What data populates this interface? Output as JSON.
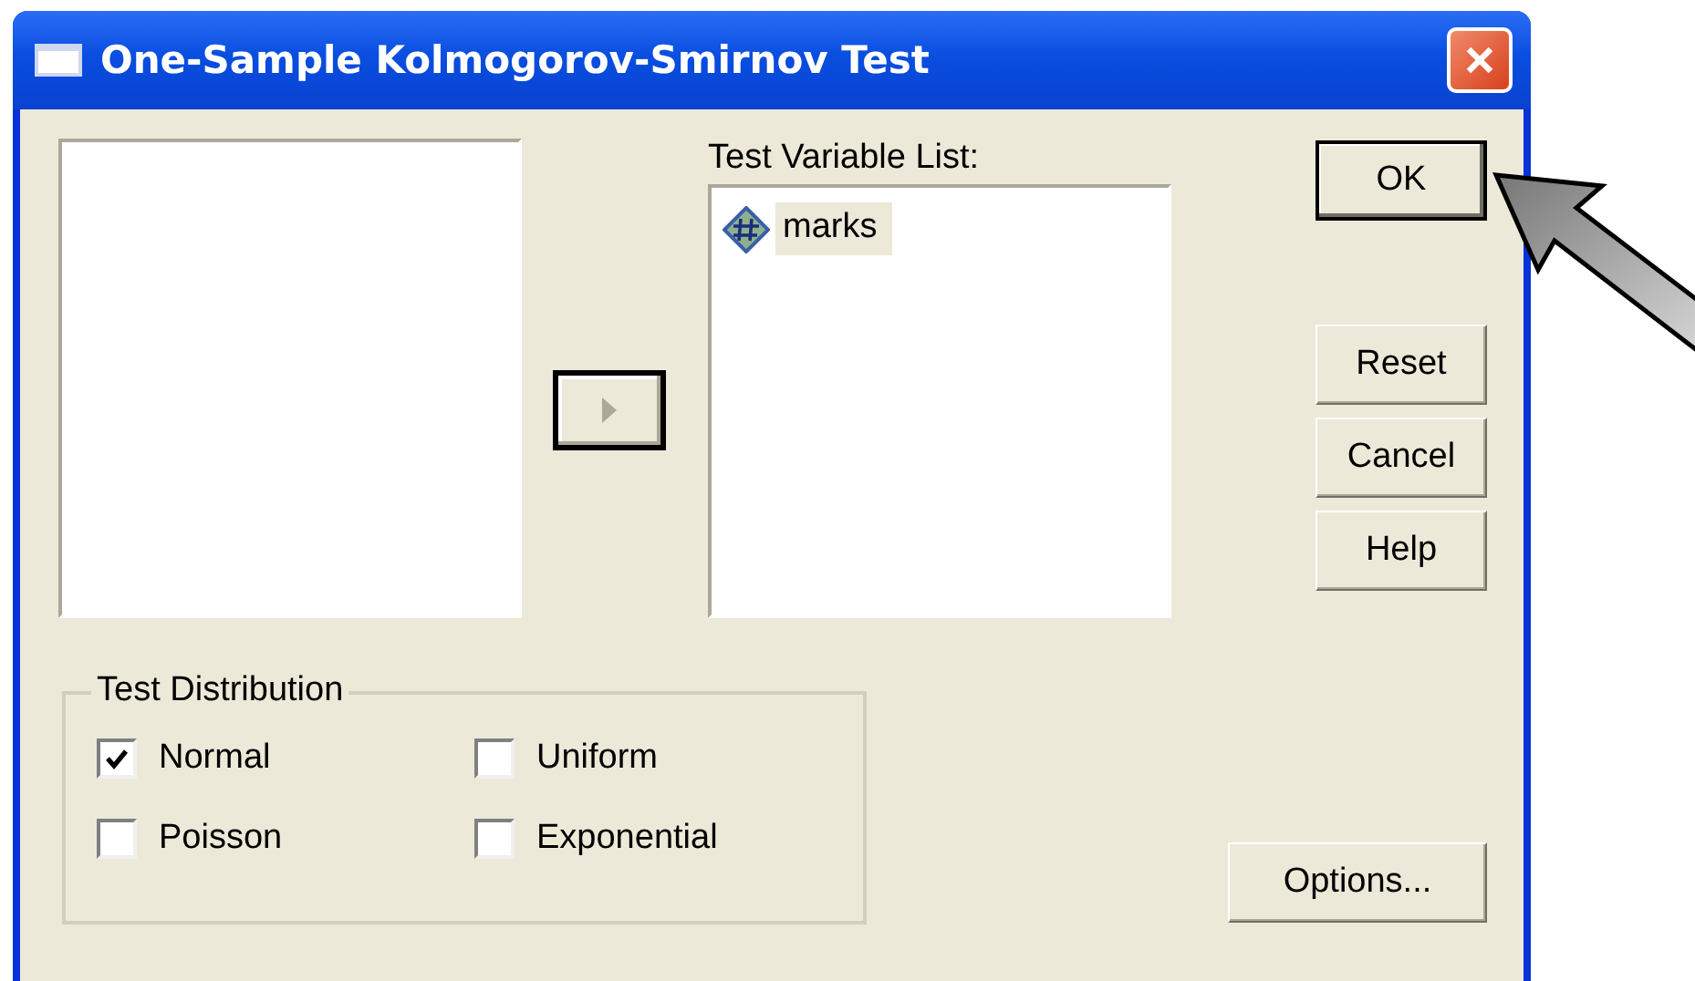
{
  "window": {
    "title": "One-Sample Kolmogorov-Smirnov Test"
  },
  "move_button": {
    "disabled": true
  },
  "test_variable_list": {
    "label": "Test Variable List:",
    "items": [
      {
        "name": "marks",
        "selected": true
      }
    ]
  },
  "buttons": [
    {
      "label": "OK",
      "default": true
    },
    {
      "label": "Reset",
      "default": false
    },
    {
      "label": "Cancel",
      "default": false
    },
    {
      "label": "Help",
      "default": false
    }
  ],
  "test_distribution": {
    "title": "Test Distribution",
    "options": [
      {
        "label": "Normal",
        "checked": true
      },
      {
        "label": "Uniform",
        "checked": false
      },
      {
        "label": "Poisson",
        "checked": false
      },
      {
        "label": "Exponential",
        "checked": false
      }
    ]
  },
  "options_button": {
    "label": "Options..."
  }
}
